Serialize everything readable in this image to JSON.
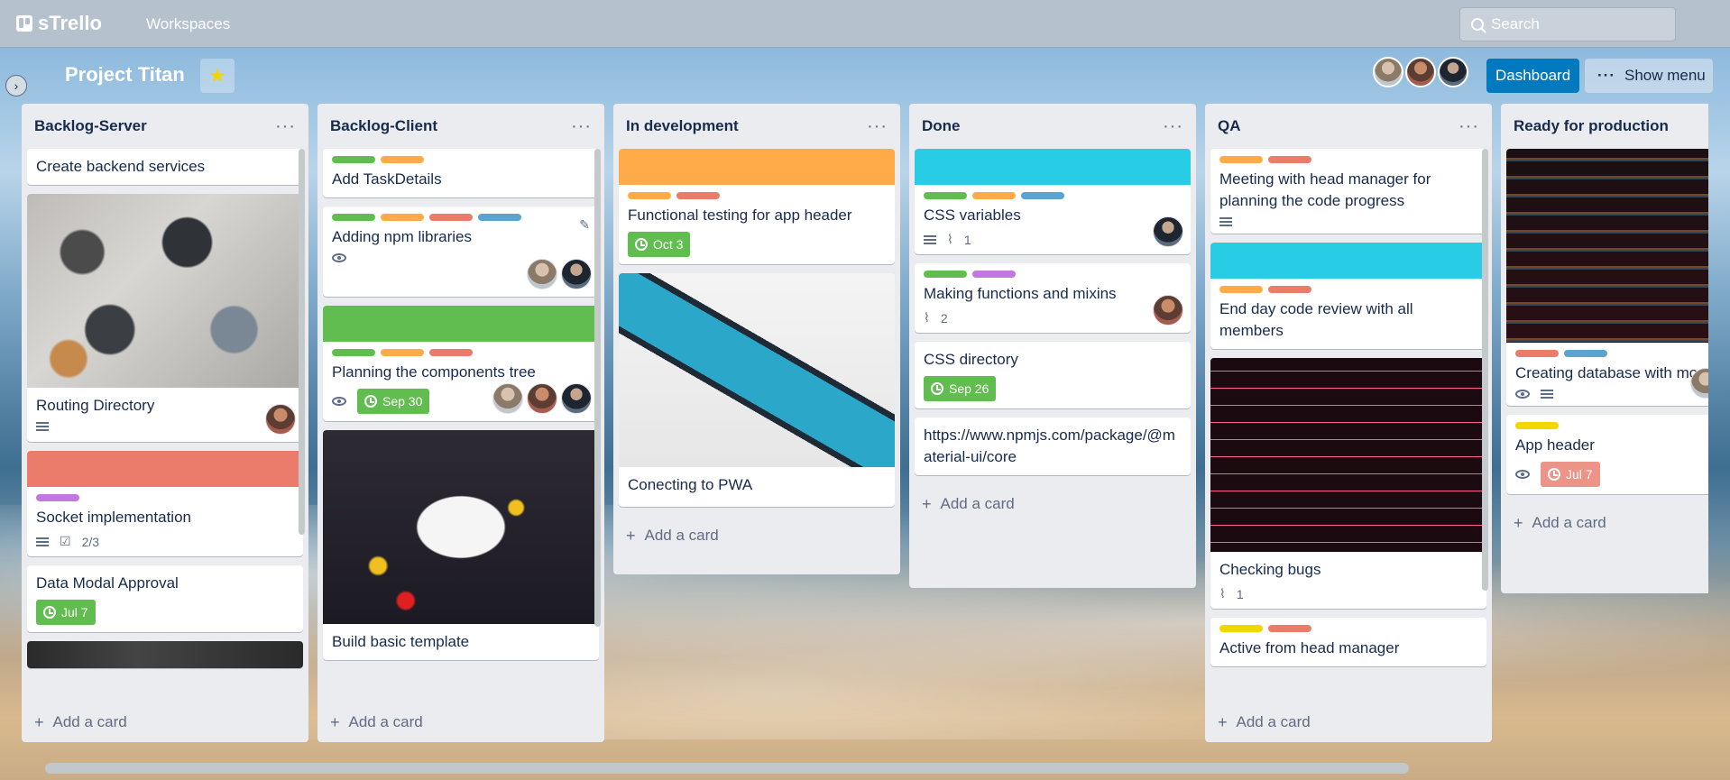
{
  "app": {
    "name": "sTrello",
    "nav_workspaces": "Workspaces",
    "search_placeholder": "Search"
  },
  "board": {
    "title": "Project Titan",
    "dashboard_label": "Dashboard",
    "show_menu_label": "Show menu",
    "add_card_label": "Add a card"
  },
  "colors": {
    "green": "#61bd4f",
    "orange": "#ffab4a",
    "red": "#eb7b6b",
    "blue": "#5ba4cf",
    "purple": "#c377e0",
    "yellow": "#f2d600",
    "sky": "#29cce5"
  },
  "lists": [
    {
      "title": "Backlog-Server",
      "cards": [
        {
          "title": "Create backend services"
        },
        {
          "title": "Routing Directory",
          "image": "desk-laptops",
          "badges": [
            "description"
          ],
          "members": 1
        },
        {
          "title": "Socket implementation",
          "cover": "red",
          "labels": [
            "purple"
          ],
          "badges": [
            "description",
            "checklist"
          ],
          "checklist": "2/3"
        },
        {
          "title": "Data Modal Approval",
          "due": "Jul 7"
        }
      ]
    },
    {
      "title": "Backlog-Client",
      "cards": [
        {
          "title": "Add TaskDetails",
          "labels": [
            "green",
            "orange"
          ]
        },
        {
          "title": "Adding npm libraries",
          "labels": [
            "green",
            "orange",
            "red",
            "blue"
          ],
          "badges": [
            "watch"
          ],
          "members": 2
        },
        {
          "title": "Planning the components tree",
          "cover": "green",
          "labels": [
            "green",
            "orange",
            "red"
          ],
          "badges": [
            "watch"
          ],
          "due": "Sep 30",
          "members": 3
        },
        {
          "title": "Build basic template",
          "image": "palette"
        }
      ]
    },
    {
      "title": "In development",
      "cards": [
        {
          "title": "Functional testing for app header",
          "cover": "orange",
          "labels": [
            "orange",
            "red"
          ],
          "due": "Oct 3"
        },
        {
          "title": "Conecting to PWA",
          "image": "phone"
        }
      ]
    },
    {
      "title": "Done",
      "cards": [
        {
          "title": "CSS variables",
          "cover": "sky",
          "labels": [
            "green",
            "orange",
            "blue"
          ],
          "badges": [
            "description",
            "attachment"
          ],
          "attachments": "1",
          "members": 1
        },
        {
          "title": "Making functions and mixins",
          "labels": [
            "green",
            "purple"
          ],
          "badges": [
            "attachment"
          ],
          "attachments": "2",
          "members": 1
        },
        {
          "title": "CSS directory",
          "due": "Sep 26"
        },
        {
          "title": "https://www.npmjs.com/package/@material-ui/core"
        }
      ]
    },
    {
      "title": "QA",
      "cards": [
        {
          "title": "Meeting with head manager for planning the code progress",
          "labels": [
            "orange",
            "red"
          ],
          "badges": [
            "description"
          ]
        },
        {
          "title": "End day code review with all members",
          "cover": "sky",
          "labels": [
            "orange",
            "red"
          ]
        },
        {
          "title": "Checking bugs",
          "image": "bugs",
          "badges": [
            "attachment"
          ],
          "attachments": "1"
        },
        {
          "title": "Active from head manager",
          "labels": [
            "yellow",
            "red"
          ]
        }
      ]
    },
    {
      "title": "Ready for production",
      "cards": [
        {
          "title": "Creating database with mor",
          "image": "code",
          "labels": [
            "red",
            "blue"
          ],
          "badges": [
            "watch",
            "description"
          ],
          "members": 1
        },
        {
          "title": "App header",
          "labels": [
            "yellow"
          ],
          "badges": [
            "watch"
          ],
          "due": "Jul 7",
          "due_overdue": true
        }
      ]
    }
  ]
}
